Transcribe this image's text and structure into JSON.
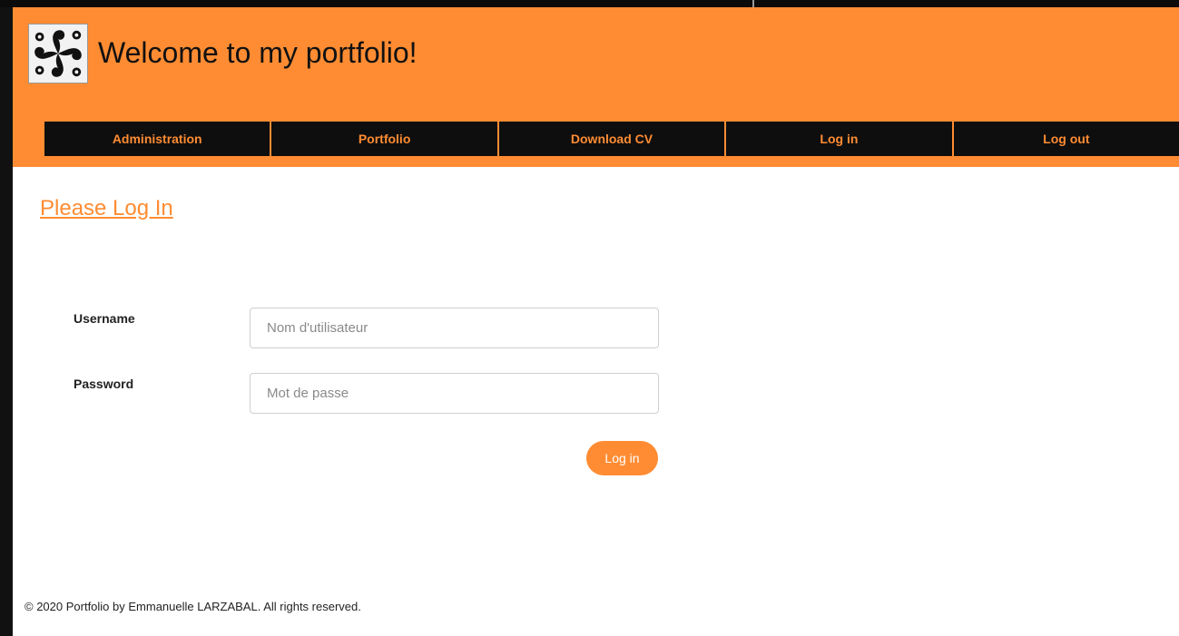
{
  "header": {
    "title": "Welcome to my portfolio!",
    "logo_icon": "lauburu-logo-icon",
    "background_color": "#ff8c33"
  },
  "nav": {
    "items": [
      {
        "label": "Administration"
      },
      {
        "label": "Portfolio"
      },
      {
        "label": "Download CV"
      },
      {
        "label": "Log in"
      },
      {
        "label": "Log out"
      }
    ]
  },
  "login": {
    "heading": "Please Log In",
    "username_label": "Username",
    "username_placeholder": "Nom d'utilisateur",
    "username_value": "",
    "password_label": "Password",
    "password_placeholder": "Mot de passe",
    "password_value": "",
    "submit_label": "Log in"
  },
  "footer": {
    "text": "© 2020 Portfolio by Emmanuelle LARZABAL. All rights reserved."
  },
  "colors": {
    "accent": "#ff8c33",
    "nav_background": "#0e0e0e"
  }
}
